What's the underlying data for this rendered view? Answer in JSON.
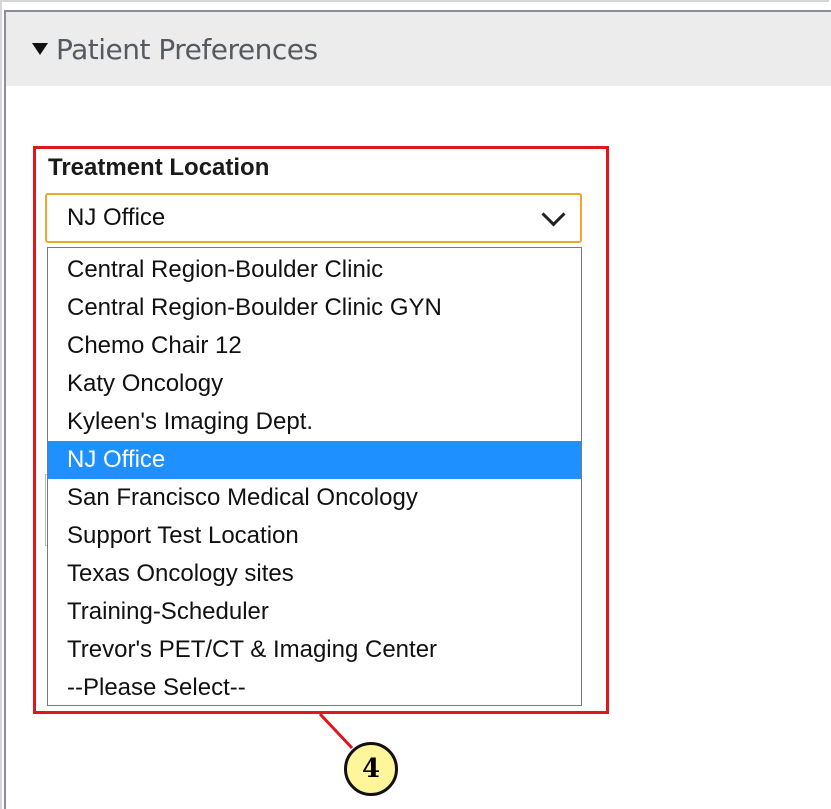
{
  "panel": {
    "title": "Patient Preferences",
    "expanded": true,
    "icon": "caret-down-icon"
  },
  "field": {
    "label": "Treatment Location",
    "selected_value": "NJ Office",
    "options": [
      "Central Region-Boulder Clinic",
      "Central Region-Boulder Clinic GYN",
      "Chemo Chair 12",
      "Katy Oncology",
      "Kyleen's Imaging Dept.",
      "NJ Office",
      "San Francisco Medical Oncology",
      "Support Test Location",
      "Texas Oncology sites",
      "Training-Scheduler",
      "Trevor's PET/CT & Imaging Center",
      "--Please Select--"
    ],
    "highlighted_index": 5
  },
  "callout": {
    "number": "4"
  },
  "colors": {
    "highlight_bg": "#1e90ff",
    "highlight_fg": "#ffffff",
    "annotation_border": "#e0161b",
    "focus_border": "#f0a62a",
    "callout_fill": "#fff59a",
    "header_bg": "#ececec"
  }
}
